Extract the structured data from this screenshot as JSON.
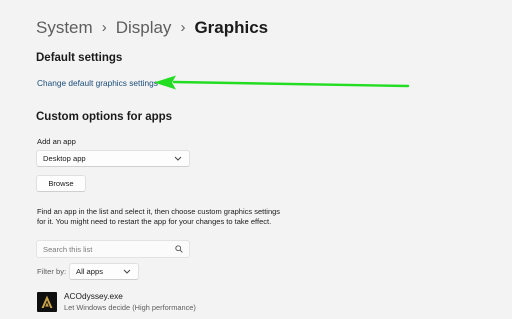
{
  "breadcrumb": {
    "items": [
      "System",
      "Display"
    ],
    "current": "Graphics",
    "separator": "›"
  },
  "default_settings": {
    "title": "Default settings",
    "link_label": "Change default graphics settings"
  },
  "custom_options": {
    "title": "Custom options for apps",
    "add_app_label": "Add an app",
    "app_type_value": "Desktop app",
    "browse_label": "Browse",
    "helper_text": "Find an app in the list and select it, then choose custom graphics settings for it. You might need to restart the app for your changes to take effect.",
    "search_placeholder": "Search this list",
    "filter_label": "Filter by:",
    "filter_value": "All apps"
  },
  "apps": [
    {
      "name": "ACOdyssey.exe",
      "setting": "Let Windows decide (High performance)",
      "icon": "assassins-creed-icon"
    }
  ],
  "annotation": {
    "arrow_color": "#22dd22",
    "icon": "green-arrow-annotation"
  },
  "colors": {
    "background": "#f3f3f3",
    "link": "#1a4c7a",
    "text": "#1b1b1b",
    "secondary_text": "#5e5e5e"
  }
}
